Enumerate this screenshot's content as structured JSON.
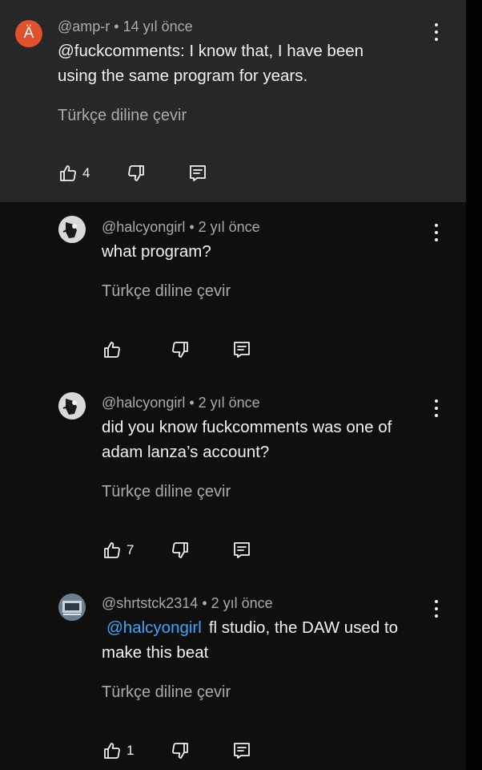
{
  "comments": [
    {
      "avatar_letter": "Ä",
      "author": "@amp-r",
      "age": "14 yıl önce",
      "text": "@fuckcomments: I know that, I have been using the same program for years.",
      "translate_label": "Türkçe diline çevir",
      "like_count": "4",
      "highlighted": true
    },
    {
      "author": "@halcyongirl",
      "age": "2 yıl önce",
      "text": "what program?",
      "translate_label": "Türkçe diline çevir",
      "like_count": ""
    },
    {
      "author": "@halcyongirl",
      "age": "2 yıl önce",
      "text": "did you know fuckcomments was one of adam lanza’s account?",
      "translate_label": "Türkçe diline çevir",
      "like_count": "7"
    },
    {
      "author": "@shrtstck2314",
      "age": "2 yıl önce",
      "mention": "@halcyongirl",
      "text": "fl studio, the DAW used to make this beat",
      "translate_label": "Türkçe diline çevir",
      "like_count": "1"
    }
  ],
  "separator": " • ",
  "icons": {
    "like": "thumbs-up-icon",
    "dislike": "thumbs-down-icon",
    "reply": "reply-comment-icon",
    "menu": "more-vertical-icon"
  },
  "colors": {
    "background": "#0f0f0f",
    "highlight": "#272727",
    "avatar_letter_bg": "#e0512c",
    "mention": "#3ea6ff",
    "secondary_text": "#aaaaaa"
  }
}
